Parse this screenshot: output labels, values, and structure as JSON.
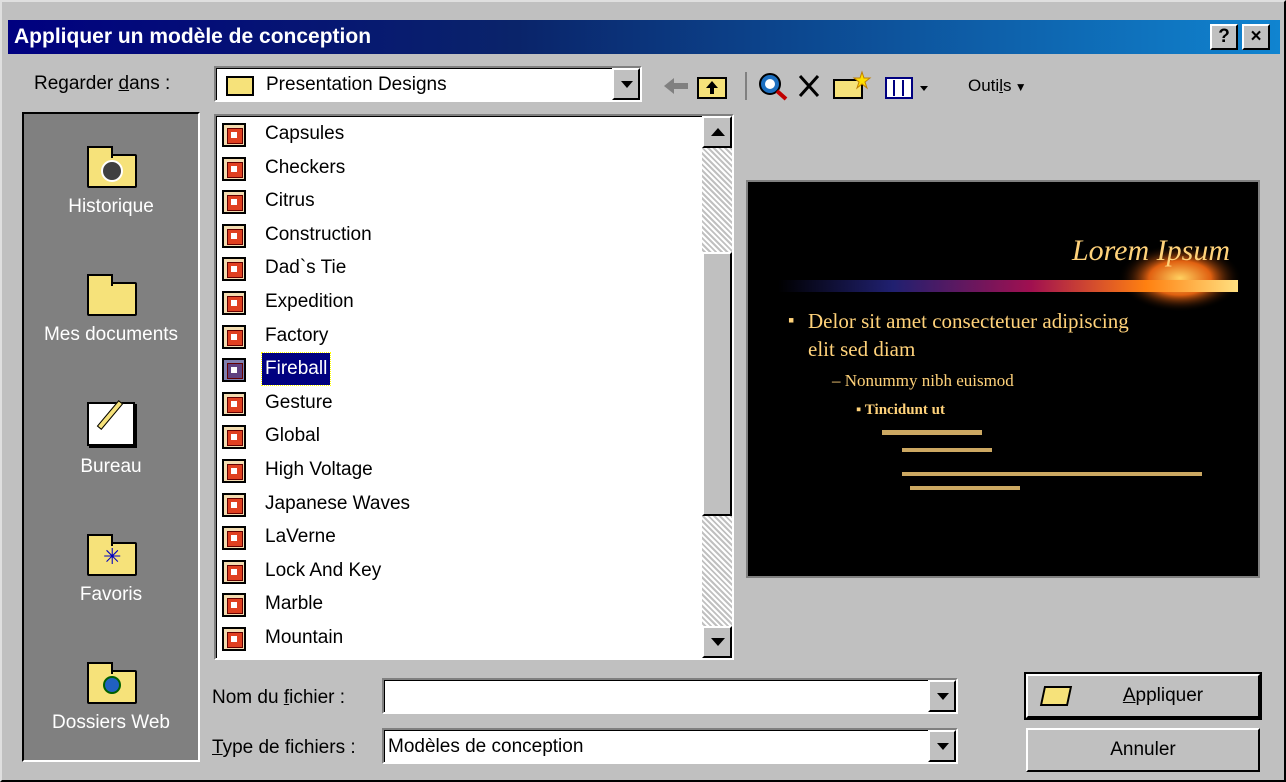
{
  "window": {
    "title": "Appliquer un modèle de conception",
    "help_label": "?",
    "close_label": "×"
  },
  "lookin": {
    "label_pre": "Regarder ",
    "label_u": "d",
    "label_post": "ans :",
    "value": "Presentation Designs"
  },
  "toolbar": {
    "tools_pre": "Outi",
    "tools_u": "l",
    "tools_post": "s"
  },
  "places": [
    {
      "label": "Historique",
      "icon": "history-icon"
    },
    {
      "label": "Mes documents",
      "icon": "my-documents-icon"
    },
    {
      "label": "Bureau",
      "icon": "desktop-icon"
    },
    {
      "label": "Favoris",
      "icon": "favorites-icon"
    },
    {
      "label": "Dossiers Web",
      "icon": "web-folders-icon"
    }
  ],
  "files": [
    "Capsules",
    "Checkers",
    "Citrus",
    "Construction",
    "Dad`s Tie",
    "Expedition",
    "Factory",
    "Fireball",
    "Gesture",
    "Global",
    "High Voltage",
    "Japanese Waves",
    "LaVerne",
    "Lock And Key",
    "Marble",
    "Mountain"
  ],
  "selected_file": "Fireball",
  "preview": {
    "title": "Lorem Ipsum",
    "bullet1": "Delor sit amet consectetuer adipiscing elit sed diam",
    "bullet2": "Nonummy nibh euismod",
    "bullet3": "Tincidunt ut"
  },
  "filename": {
    "label_pre": "Nom du ",
    "label_u": "f",
    "label_post": "ichier :",
    "value": ""
  },
  "filetype": {
    "label_pre": "",
    "label_u": "T",
    "label_post": "ype de fichiers :",
    "value": "Modèles de conception"
  },
  "buttons": {
    "apply_u": "A",
    "apply_rest": "ppliquer",
    "cancel": "Annuler"
  },
  "colors": {
    "title_bar": "#000080",
    "selection": "#000080",
    "preview_bg": "#000000",
    "preview_text": "#ffd27a"
  }
}
